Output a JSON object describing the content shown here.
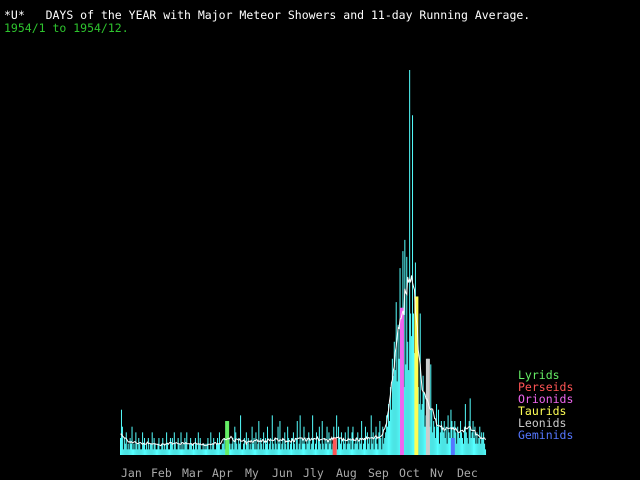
{
  "header": {
    "marker": "*U*",
    "title": "DAYS of the YEAR with Major Meteor Showers and 11-day Running Average.",
    "range": "1954/1 to 1954/12.",
    "range_color": "#2ec42e"
  },
  "legend": [
    {
      "label": "Lyrids",
      "color": "#66ee66"
    },
    {
      "label": "Perseids",
      "color": "#ff5555"
    },
    {
      "label": "Orionids",
      "color": "#ee66ee"
    },
    {
      "label": "Taurids",
      "color": "#ffff55"
    },
    {
      "label": "Leonids",
      "color": "#cccccc"
    },
    {
      "label": "Geminids",
      "color": "#5577ff"
    }
  ],
  "chart_data": {
    "type": "bar",
    "x_unit": "day of year",
    "months": [
      "Jan",
      "Feb",
      "Mar",
      "Apr",
      "My",
      "Jun",
      "Jly",
      "Aug",
      "Sep",
      "Oct",
      "Nv",
      "Dec"
    ],
    "bar_color": "#55ffff",
    "avg_color": "#ffffff",
    "grid": false,
    "showers": [
      {
        "name": "Lyrids",
        "days": [
          112
        ],
        "color": "#66ee66"
      },
      {
        "name": "Perseids",
        "days": [
          224
        ],
        "color": "#ff5555"
      },
      {
        "name": "Orionids",
        "days": [
          294
        ],
        "color": "#ee66ee"
      },
      {
        "name": "Taurids",
        "days": [
          309
        ],
        "color": "#ffff55"
      },
      {
        "name": "Leonids",
        "days": [
          321
        ],
        "color": "#cccccc"
      },
      {
        "name": "Geminids",
        "days": [
          347
        ],
        "color": "#5577ff"
      }
    ],
    "values": [
      3,
      8,
      5,
      1,
      3,
      2,
      4,
      1,
      2,
      1,
      3,
      2,
      5,
      1,
      2,
      1,
      4,
      2,
      1,
      3,
      2,
      1,
      1,
      4,
      2,
      3,
      1,
      2,
      1,
      3,
      1,
      2,
      2,
      4,
      1,
      3,
      2,
      1,
      1,
      2,
      3,
      1,
      1,
      2,
      3,
      1,
      2,
      1,
      4,
      2,
      1,
      1,
      3,
      2,
      3,
      1,
      4,
      2,
      1,
      1,
      3,
      2,
      1,
      4,
      1,
      2,
      1,
      3,
      2,
      4,
      1,
      1,
      2,
      3,
      2,
      1,
      2,
      1,
      3,
      2,
      1,
      4,
      2,
      3,
      1,
      1,
      2,
      1,
      2,
      1,
      2,
      3,
      1,
      1,
      4,
      1,
      2,
      3,
      1,
      1,
      2,
      3,
      2,
      4,
      1,
      1,
      2,
      2,
      3,
      1,
      4,
      6,
      5,
      3,
      2,
      1,
      2,
      3,
      1,
      5,
      4,
      2,
      1,
      3,
      2,
      7,
      1,
      1,
      2,
      3,
      1,
      4,
      2,
      3,
      1,
      2,
      1,
      5,
      2,
      3,
      1,
      4,
      1,
      2,
      6,
      1,
      3,
      2,
      1,
      4,
      1,
      3,
      2,
      5,
      1,
      2,
      3,
      1,
      7,
      2,
      1,
      3,
      2,
      1,
      5,
      2,
      6,
      1,
      2,
      3,
      1,
      4,
      2,
      1,
      5,
      3,
      1,
      2,
      3,
      1,
      4,
      2,
      1,
      3,
      6,
      1,
      2,
      7,
      1,
      3,
      2,
      5,
      2,
      1,
      3,
      2,
      4,
      3,
      1,
      2,
      7,
      3,
      1,
      2,
      4,
      1,
      3,
      5,
      2,
      1,
      6,
      2,
      1,
      3,
      2,
      5,
      1,
      4,
      2,
      3,
      1,
      2,
      5,
      3,
      1,
      7,
      1,
      5,
      3,
      2,
      4,
      1,
      3,
      2,
      4,
      1,
      2,
      5,
      2,
      3,
      1,
      4,
      5,
      1,
      2,
      3,
      2,
      4,
      1,
      3,
      2,
      6,
      1,
      2,
      3,
      5,
      1,
      4,
      2,
      3,
      1,
      7,
      2,
      4,
      1,
      3,
      5,
      2,
      1,
      4,
      6,
      3,
      1,
      5,
      2,
      3,
      4,
      7,
      5,
      9,
      6,
      12,
      8,
      17,
      14,
      20,
      15,
      27,
      13,
      23,
      17,
      33,
      24,
      26,
      36,
      12,
      38,
      16,
      35,
      20,
      15,
      68,
      25,
      21,
      60,
      25,
      18,
      34,
      28,
      21,
      12,
      9,
      25,
      8,
      9,
      14,
      11,
      5,
      7,
      6,
      17,
      11,
      5,
      16,
      8,
      4,
      6,
      5,
      3,
      9,
      5,
      8,
      2,
      4,
      6,
      5,
      4,
      6,
      3,
      5,
      2,
      7,
      4,
      3,
      8,
      6,
      3,
      5,
      6,
      4,
      2,
      5,
      4,
      3,
      6,
      4,
      3,
      2,
      5,
      9,
      4,
      3,
      2,
      6,
      10,
      3,
      4,
      6,
      3,
      5,
      2,
      4,
      2,
      3,
      5,
      2,
      4,
      3,
      4,
      2,
      1
    ],
    "avg_window": 11
  }
}
